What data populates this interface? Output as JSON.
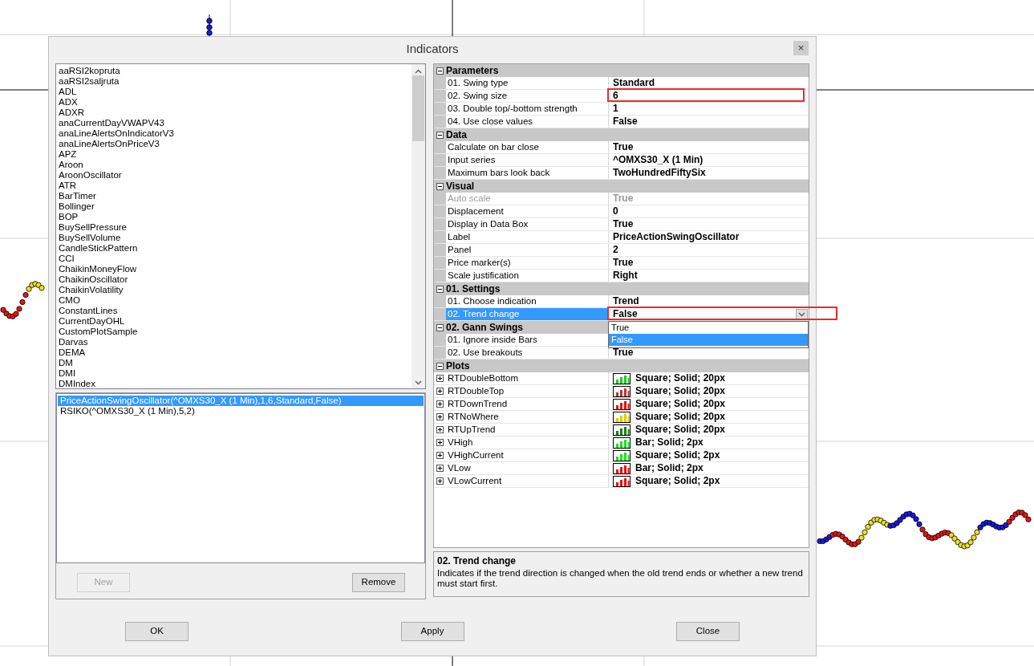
{
  "window": {
    "title": "Indicators",
    "close_label": "×"
  },
  "available_indicators": [
    "aaRSI2kopruta",
    "aaRSI2saljruta",
    "ADL",
    "ADX",
    "ADXR",
    "anaCurrentDayVWAPV43",
    "anaLineAlertsOnIndicatorV3",
    "anaLineAlertsOnPriceV3",
    "APZ",
    "Aroon",
    "AroonOscillator",
    "ATR",
    "BarTimer",
    "Bollinger",
    "BOP",
    "BuySellPressure",
    "BuySellVolume",
    "CandleStickPattern",
    "CCI",
    "ChaikinMoneyFlow",
    "ChaikinOscillator",
    "ChaikinVolatility",
    "CMO",
    "ConstantLines",
    "CurrentDayOHL",
    "CustomPlotSample",
    "Darvas",
    "DEMA",
    "DM",
    "DMI",
    "DMIndex"
  ],
  "applied_indicators": [
    {
      "label": "PriceActionSwingOscillator(^OMXS30_X (1 Min),1,6,Standard,False)",
      "selected": true
    },
    {
      "label": "RSIKO(^OMXS30_X (1 Min),5,2)",
      "selected": false
    }
  ],
  "list_buttons": [
    {
      "label": "New",
      "disabled": true
    },
    {
      "label": "Remove",
      "disabled": false
    }
  ],
  "property_grid": {
    "categories": [
      {
        "name": "Parameters",
        "expanded": true,
        "properties": [
          {
            "name": "01. Swing type",
            "value": "Standard",
            "selected": false,
            "disabled": false,
            "highlighted": false
          },
          {
            "name": "02. Swing size",
            "value": "6",
            "selected": false,
            "disabled": false,
            "highlighted": true
          },
          {
            "name": "03. Double top/-bottom strength",
            "value": "1",
            "selected": false,
            "disabled": false,
            "highlighted": false
          },
          {
            "name": "04. Use close values",
            "value": "False",
            "selected": false,
            "disabled": false,
            "highlighted": false
          }
        ]
      },
      {
        "name": "Data",
        "expanded": true,
        "properties": [
          {
            "name": "Calculate on bar close",
            "value": "True",
            "selected": false,
            "disabled": false,
            "highlighted": false
          },
          {
            "name": "Input series",
            "value": "^OMXS30_X (1 Min)",
            "selected": false,
            "disabled": false,
            "highlighted": false
          },
          {
            "name": "Maximum bars look back",
            "value": "TwoHundredFiftySix",
            "selected": false,
            "disabled": false,
            "highlighted": false
          }
        ]
      },
      {
        "name": "Visual",
        "expanded": true,
        "properties": [
          {
            "name": "Auto scale",
            "value": "True",
            "selected": false,
            "disabled": true,
            "highlighted": false
          },
          {
            "name": "Displacement",
            "value": "0",
            "selected": false,
            "disabled": false,
            "highlighted": false
          },
          {
            "name": "Display in Data Box",
            "value": "True",
            "selected": false,
            "disabled": false,
            "highlighted": false
          },
          {
            "name": "Label",
            "value": "PriceActionSwingOscillator",
            "selected": false,
            "disabled": false,
            "highlighted": false
          },
          {
            "name": "Panel",
            "value": "2",
            "selected": false,
            "disabled": false,
            "highlighted": false
          },
          {
            "name": "Price marker(s)",
            "value": "True",
            "selected": false,
            "disabled": false,
            "highlighted": false
          },
          {
            "name": "Scale justification",
            "value": "Right",
            "selected": false,
            "disabled": false,
            "highlighted": false
          }
        ]
      },
      {
        "name": "01. Settings",
        "expanded": true,
        "properties": [
          {
            "name": "01. Choose indication",
            "value": "Trend",
            "selected": false,
            "disabled": false,
            "highlighted": false
          },
          {
            "name": "02. Trend change",
            "value": "False",
            "selected": true,
            "disabled": false,
            "highlighted": true,
            "kind": "dropdown",
            "options": [
              {
                "label": "True",
                "selected": false
              },
              {
                "label": "False",
                "selected": true
              }
            ]
          }
        ]
      },
      {
        "name": "02. Gann Swings",
        "expanded": true,
        "properties": [
          {
            "name": "01. Ignore inside Bars",
            "selected": false,
            "disabled": false,
            "highlighted": false
          },
          {
            "name": "02. Use breakouts",
            "value": "True",
            "selected": false,
            "disabled": false,
            "highlighted": false
          }
        ]
      },
      {
        "name": "Plots",
        "expanded": true,
        "properties": [
          {
            "name": "RTDoubleBottom",
            "value": "Square; Solid; 20px",
            "kind": "plot",
            "color": "#22c822",
            "expanded": false,
            "selected": false,
            "disabled": false,
            "highlighted": false
          },
          {
            "name": "RTDoubleTop",
            "value": "Square; Solid; 20px",
            "kind": "plot",
            "color": "#b03a3a",
            "expanded": false,
            "selected": false,
            "disabled": false,
            "highlighted": false
          },
          {
            "name": "RTDownTrend",
            "value": "Square; Solid; 20px",
            "kind": "plot",
            "color": "#e81010",
            "expanded": false,
            "selected": false,
            "disabled": false,
            "highlighted": false
          },
          {
            "name": "RTNoWhere",
            "value": "Square; Solid; 20px",
            "kind": "plot",
            "color": "#e8c800",
            "expanded": false,
            "selected": false,
            "disabled": false,
            "highlighted": false
          },
          {
            "name": "RTUpTrend",
            "value": "Square; Solid; 20px",
            "kind": "plot",
            "color": "#1e7a1e",
            "expanded": false,
            "selected": false,
            "disabled": false,
            "highlighted": false
          },
          {
            "name": "VHigh",
            "value": "Bar; Solid; 2px",
            "kind": "plot",
            "color": "#22dd22",
            "expanded": false,
            "selected": false,
            "disabled": false,
            "highlighted": false
          },
          {
            "name": "VHighCurrent",
            "value": "Square; Solid; 2px",
            "kind": "plot",
            "color": "#22dd22",
            "expanded": false,
            "selected": false,
            "disabled": false,
            "highlighted": false
          },
          {
            "name": "VLow",
            "value": "Bar; Solid; 2px",
            "kind": "plot",
            "color": "#e81010",
            "expanded": false,
            "selected": false,
            "disabled": false,
            "highlighted": false
          },
          {
            "name": "VLowCurrent",
            "value": "Square; Solid; 2px",
            "kind": "plot",
            "color": "#e81010",
            "expanded": false,
            "selected": false,
            "disabled": false,
            "highlighted": false
          }
        ]
      }
    ]
  },
  "description": {
    "title": "02. Trend change",
    "text": "Indicates if the trend direction is changed when the old trend ends or whether a new trend must start first."
  },
  "dialog_buttons": [
    {
      "label": "OK"
    },
    {
      "label": "Apply"
    },
    {
      "label": "Close"
    }
  ]
}
